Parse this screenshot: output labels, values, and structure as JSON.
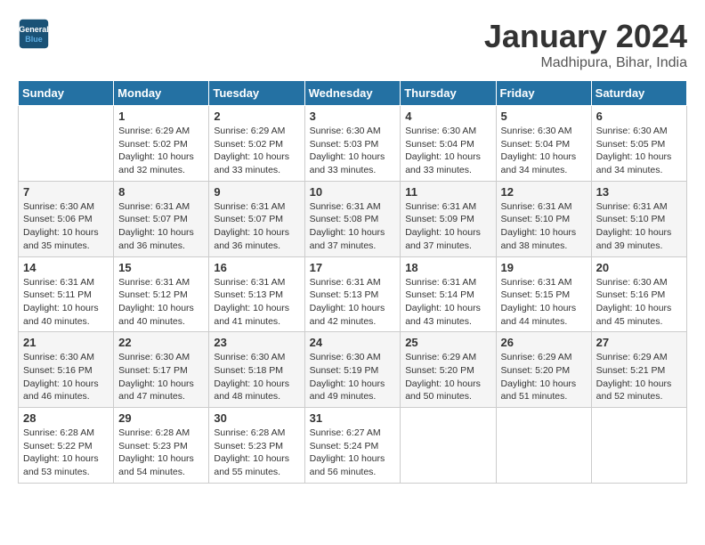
{
  "logo": {
    "line1": "General",
    "line2": "Blue"
  },
  "title": "January 2024",
  "location": "Madhipura, Bihar, India",
  "weekdays": [
    "Sunday",
    "Monday",
    "Tuesday",
    "Wednesday",
    "Thursday",
    "Friday",
    "Saturday"
  ],
  "weeks": [
    [
      {
        "day": "",
        "sunrise": "",
        "sunset": "",
        "daylight": ""
      },
      {
        "day": "1",
        "sunrise": "Sunrise: 6:29 AM",
        "sunset": "Sunset: 5:02 PM",
        "daylight": "Daylight: 10 hours and 32 minutes."
      },
      {
        "day": "2",
        "sunrise": "Sunrise: 6:29 AM",
        "sunset": "Sunset: 5:02 PM",
        "daylight": "Daylight: 10 hours and 33 minutes."
      },
      {
        "day": "3",
        "sunrise": "Sunrise: 6:30 AM",
        "sunset": "Sunset: 5:03 PM",
        "daylight": "Daylight: 10 hours and 33 minutes."
      },
      {
        "day": "4",
        "sunrise": "Sunrise: 6:30 AM",
        "sunset": "Sunset: 5:04 PM",
        "daylight": "Daylight: 10 hours and 33 minutes."
      },
      {
        "day": "5",
        "sunrise": "Sunrise: 6:30 AM",
        "sunset": "Sunset: 5:04 PM",
        "daylight": "Daylight: 10 hours and 34 minutes."
      },
      {
        "day": "6",
        "sunrise": "Sunrise: 6:30 AM",
        "sunset": "Sunset: 5:05 PM",
        "daylight": "Daylight: 10 hours and 34 minutes."
      }
    ],
    [
      {
        "day": "7",
        "sunrise": "Sunrise: 6:30 AM",
        "sunset": "Sunset: 5:06 PM",
        "daylight": "Daylight: 10 hours and 35 minutes."
      },
      {
        "day": "8",
        "sunrise": "Sunrise: 6:31 AM",
        "sunset": "Sunset: 5:07 PM",
        "daylight": "Daylight: 10 hours and 36 minutes."
      },
      {
        "day": "9",
        "sunrise": "Sunrise: 6:31 AM",
        "sunset": "Sunset: 5:07 PM",
        "daylight": "Daylight: 10 hours and 36 minutes."
      },
      {
        "day": "10",
        "sunrise": "Sunrise: 6:31 AM",
        "sunset": "Sunset: 5:08 PM",
        "daylight": "Daylight: 10 hours and 37 minutes."
      },
      {
        "day": "11",
        "sunrise": "Sunrise: 6:31 AM",
        "sunset": "Sunset: 5:09 PM",
        "daylight": "Daylight: 10 hours and 37 minutes."
      },
      {
        "day": "12",
        "sunrise": "Sunrise: 6:31 AM",
        "sunset": "Sunset: 5:10 PM",
        "daylight": "Daylight: 10 hours and 38 minutes."
      },
      {
        "day": "13",
        "sunrise": "Sunrise: 6:31 AM",
        "sunset": "Sunset: 5:10 PM",
        "daylight": "Daylight: 10 hours and 39 minutes."
      }
    ],
    [
      {
        "day": "14",
        "sunrise": "Sunrise: 6:31 AM",
        "sunset": "Sunset: 5:11 PM",
        "daylight": "Daylight: 10 hours and 40 minutes."
      },
      {
        "day": "15",
        "sunrise": "Sunrise: 6:31 AM",
        "sunset": "Sunset: 5:12 PM",
        "daylight": "Daylight: 10 hours and 40 minutes."
      },
      {
        "day": "16",
        "sunrise": "Sunrise: 6:31 AM",
        "sunset": "Sunset: 5:13 PM",
        "daylight": "Daylight: 10 hours and 41 minutes."
      },
      {
        "day": "17",
        "sunrise": "Sunrise: 6:31 AM",
        "sunset": "Sunset: 5:13 PM",
        "daylight": "Daylight: 10 hours and 42 minutes."
      },
      {
        "day": "18",
        "sunrise": "Sunrise: 6:31 AM",
        "sunset": "Sunset: 5:14 PM",
        "daylight": "Daylight: 10 hours and 43 minutes."
      },
      {
        "day": "19",
        "sunrise": "Sunrise: 6:31 AM",
        "sunset": "Sunset: 5:15 PM",
        "daylight": "Daylight: 10 hours and 44 minutes."
      },
      {
        "day": "20",
        "sunrise": "Sunrise: 6:30 AM",
        "sunset": "Sunset: 5:16 PM",
        "daylight": "Daylight: 10 hours and 45 minutes."
      }
    ],
    [
      {
        "day": "21",
        "sunrise": "Sunrise: 6:30 AM",
        "sunset": "Sunset: 5:16 PM",
        "daylight": "Daylight: 10 hours and 46 minutes."
      },
      {
        "day": "22",
        "sunrise": "Sunrise: 6:30 AM",
        "sunset": "Sunset: 5:17 PM",
        "daylight": "Daylight: 10 hours and 47 minutes."
      },
      {
        "day": "23",
        "sunrise": "Sunrise: 6:30 AM",
        "sunset": "Sunset: 5:18 PM",
        "daylight": "Daylight: 10 hours and 48 minutes."
      },
      {
        "day": "24",
        "sunrise": "Sunrise: 6:30 AM",
        "sunset": "Sunset: 5:19 PM",
        "daylight": "Daylight: 10 hours and 49 minutes."
      },
      {
        "day": "25",
        "sunrise": "Sunrise: 6:29 AM",
        "sunset": "Sunset: 5:20 PM",
        "daylight": "Daylight: 10 hours and 50 minutes."
      },
      {
        "day": "26",
        "sunrise": "Sunrise: 6:29 AM",
        "sunset": "Sunset: 5:20 PM",
        "daylight": "Daylight: 10 hours and 51 minutes."
      },
      {
        "day": "27",
        "sunrise": "Sunrise: 6:29 AM",
        "sunset": "Sunset: 5:21 PM",
        "daylight": "Daylight: 10 hours and 52 minutes."
      }
    ],
    [
      {
        "day": "28",
        "sunrise": "Sunrise: 6:28 AM",
        "sunset": "Sunset: 5:22 PM",
        "daylight": "Daylight: 10 hours and 53 minutes."
      },
      {
        "day": "29",
        "sunrise": "Sunrise: 6:28 AM",
        "sunset": "Sunset: 5:23 PM",
        "daylight": "Daylight: 10 hours and 54 minutes."
      },
      {
        "day": "30",
        "sunrise": "Sunrise: 6:28 AM",
        "sunset": "Sunset: 5:23 PM",
        "daylight": "Daylight: 10 hours and 55 minutes."
      },
      {
        "day": "31",
        "sunrise": "Sunrise: 6:27 AM",
        "sunset": "Sunset: 5:24 PM",
        "daylight": "Daylight: 10 hours and 56 minutes."
      },
      {
        "day": "",
        "sunrise": "",
        "sunset": "",
        "daylight": ""
      },
      {
        "day": "",
        "sunrise": "",
        "sunset": "",
        "daylight": ""
      },
      {
        "day": "",
        "sunrise": "",
        "sunset": "",
        "daylight": ""
      }
    ]
  ]
}
